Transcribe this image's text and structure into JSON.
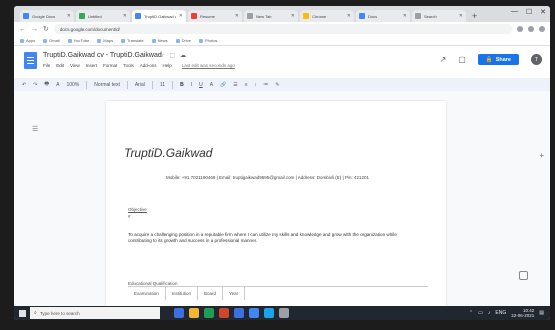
{
  "browser": {
    "tabs": [
      {
        "title": "Google Docs",
        "color": "#4285f4",
        "active": false
      },
      {
        "title": "Untitled",
        "color": "#34a853",
        "active": false
      },
      {
        "title": "TruptiD.Gaikwad cv",
        "color": "#4285f4",
        "active": true
      },
      {
        "title": "Resume",
        "color": "#ea4335",
        "active": false
      },
      {
        "title": "New Tab",
        "color": "#9aa0a6",
        "active": false
      },
      {
        "title": "Chrome",
        "color": "#fbbc05",
        "active": false
      },
      {
        "title": "Docs",
        "color": "#4285f4",
        "active": false
      },
      {
        "title": "Search",
        "color": "#9aa0a6",
        "active": false
      }
    ],
    "new_tab_symbol": "+",
    "window_controls": [
      "—",
      "☐",
      "✕"
    ],
    "url": "docs.google.com/document/d/",
    "bookmarks": [
      "Apps",
      "Gmail",
      "YouTube",
      "Maps",
      "Translate",
      "News",
      "Drive",
      "Photos"
    ]
  },
  "docs": {
    "title": "TruptiD.Gaikwad cv - TruptiD.Gaikwad",
    "title_icons": [
      "☆",
      "⬚",
      "☁"
    ],
    "menu": [
      "File",
      "Edit",
      "View",
      "Insert",
      "Format",
      "Tools",
      "Add-ons",
      "Help"
    ],
    "last_edit": "Last edit was seconds ago",
    "share_label": "Share",
    "avatar_initial": "T"
  },
  "toolbar": {
    "items": [
      "↶",
      "↷",
      "🖶",
      "A",
      "100%",
      "Normal text",
      "Arial",
      "11",
      "B",
      "I",
      "U",
      "A",
      "🔗",
      "☰",
      "≡",
      "⁝",
      "≔",
      "✎"
    ],
    "style": "Normal text",
    "font": "Arial",
    "size": "11",
    "zoom": "100%"
  },
  "document": {
    "name": "TruptiD.Gaikwad",
    "contact": "Mobile: +91 7021190469 | Email: truptigaikwad9595@gmail.com | Address: Dombivli (E) | Pin: 421201",
    "section1_title": "Objective",
    "section1_mark": "#",
    "objective": "To acquire a challenging position in a reputable firm where I can utilize my skills and knowledge and grow with the organization while contributing to its growth and success in a professional manner.",
    "section2_title": "Educational Qualification",
    "table_cells": [
      "Examination",
      "Institution",
      "Board",
      "Year"
    ]
  },
  "taskbar": {
    "search_placeholder": "Type here to search",
    "apps": [
      "#3c6fe0",
      "#f2b632",
      "#1f9d55",
      "#d0452b",
      "#3c6fe0",
      "#4285f4",
      "#1aa3e8",
      "#9aa0a6"
    ],
    "tray_text": "ENG",
    "time": "10:42",
    "date": "22-06-2021"
  },
  "colors": {
    "share": "#1a73e8",
    "docs_blue": "#4285f4"
  }
}
